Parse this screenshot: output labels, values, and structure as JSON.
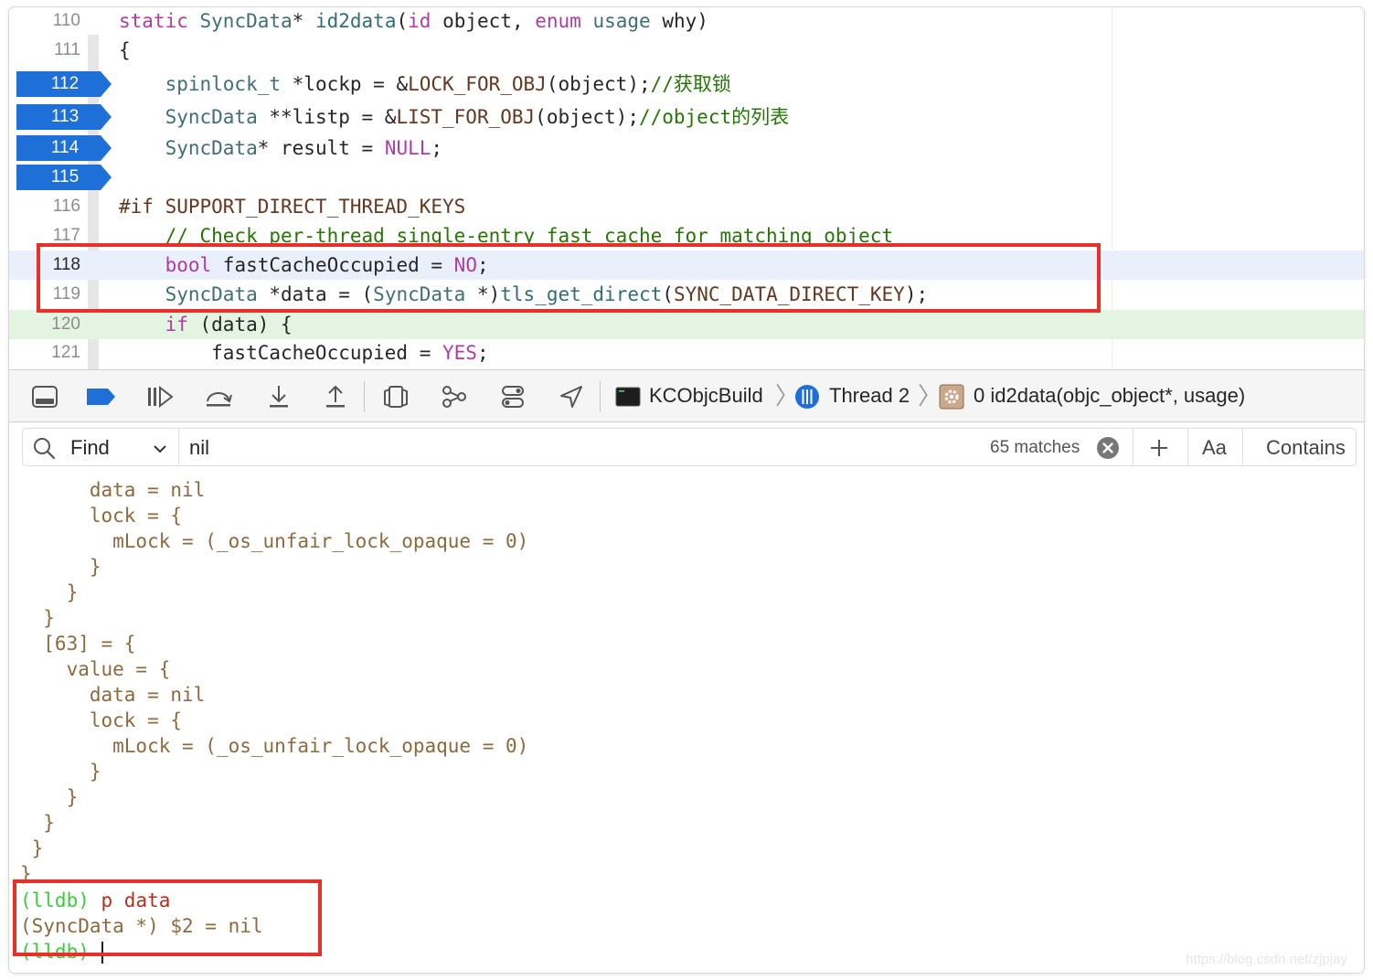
{
  "editor": {
    "lines": [
      {
        "num": "110",
        "type": "normal",
        "tokens": [
          [
            "kw",
            "static "
          ],
          [
            "ty",
            "SyncData"
          ],
          [
            "tx",
            "* "
          ],
          [
            "fn",
            "id2data"
          ],
          [
            "tx",
            "("
          ],
          [
            "kw",
            "id"
          ],
          [
            "tx",
            " object, "
          ],
          [
            "kw",
            "enum "
          ],
          [
            "ty",
            "usage"
          ],
          [
            "tx",
            " why)"
          ]
        ]
      },
      {
        "num": "111",
        "type": "normal",
        "tokens": [
          [
            "tx",
            "{"
          ]
        ]
      },
      {
        "num": "112",
        "type": "breakpoint",
        "tokens": [
          [
            "tx",
            "    "
          ],
          [
            "ty",
            "spinlock_t"
          ],
          [
            "tx",
            " *lockp = &"
          ],
          [
            "mac",
            "LOCK_FOR_OBJ"
          ],
          [
            "tx",
            "(object);"
          ],
          [
            "cm",
            "//获取锁"
          ]
        ]
      },
      {
        "num": "113",
        "type": "breakpoint",
        "tokens": [
          [
            "tx",
            "    "
          ],
          [
            "ty",
            "SyncData"
          ],
          [
            "tx",
            " **listp = &"
          ],
          [
            "mac",
            "LIST_FOR_OBJ"
          ],
          [
            "tx",
            "(object);"
          ],
          [
            "cm",
            "//object的列表"
          ]
        ]
      },
      {
        "num": "114",
        "type": "breakpoint",
        "tokens": [
          [
            "tx",
            "    "
          ],
          [
            "ty",
            "SyncData"
          ],
          [
            "tx",
            "* result = "
          ],
          [
            "kw",
            "NULL"
          ],
          [
            "tx",
            ";"
          ]
        ]
      },
      {
        "num": "115",
        "type": "breakpoint",
        "tokens": []
      },
      {
        "num": "116",
        "type": "normal",
        "tokens": [
          [
            "pre",
            "#if SUPPORT_DIRECT_THREAD_KEYS"
          ]
        ]
      },
      {
        "num": "117",
        "type": "normal",
        "tokens": [
          [
            "tx",
            "    "
          ],
          [
            "cm",
            "// Check per-thread single-entry fast cache for matching object"
          ]
        ]
      },
      {
        "num": "118",
        "type": "current",
        "tokens": [
          [
            "tx",
            "    "
          ],
          [
            "kw",
            "bool"
          ],
          [
            "tx",
            " fastCacheOccupied = "
          ],
          [
            "kw",
            "NO"
          ],
          [
            "tx",
            ";"
          ]
        ]
      },
      {
        "num": "119",
        "type": "normal",
        "tokens": [
          [
            "tx",
            "    "
          ],
          [
            "ty",
            "SyncData"
          ],
          [
            "tx",
            " *data = ("
          ],
          [
            "ty",
            "SyncData"
          ],
          [
            "tx",
            " *)"
          ],
          [
            "fn",
            "tls_get_direct"
          ],
          [
            "tx",
            "("
          ],
          [
            "mac",
            "SYNC_DATA_DIRECT_KEY"
          ],
          [
            "tx",
            ");"
          ]
        ]
      },
      {
        "num": "120",
        "type": "exec",
        "tokens": [
          [
            "tx",
            "    "
          ],
          [
            "kw",
            "if"
          ],
          [
            "tx",
            " (data) {"
          ]
        ]
      },
      {
        "num": "121",
        "type": "normal",
        "tokens": [
          [
            "tx",
            "        fastCacheOccupied = "
          ],
          [
            "kw",
            "YES"
          ],
          [
            "tx",
            ";"
          ]
        ]
      }
    ]
  },
  "debug_bar": {
    "target": "KCObjcBuild",
    "thread": "Thread 2",
    "frame": "0 id2data(objc_object*, usage)"
  },
  "find_bar": {
    "mode": "Find",
    "query": "nil",
    "matches": "65 matches",
    "case_label": "Aa",
    "match_type": "Contains"
  },
  "console": {
    "lines": [
      "      data = nil",
      "      lock = {",
      "        mLock = (_os_unfair_lock_opaque = 0)",
      "      }",
      "    }",
      "  }",
      "  [63] = {",
      "    value = {",
      "      data = nil",
      "      lock = {",
      "        mLock = (_os_unfair_lock_opaque = 0)",
      "      }",
      "    }",
      "  }",
      " }",
      "}"
    ],
    "prompt": "(lldb)",
    "command": "p data",
    "result": "(SyncData *) $2 = nil"
  },
  "watermark": "https://blog.csdn.net/zjpjay",
  "colors": {
    "breakpoint": "#1f6fd8",
    "highlight_box": "#e8302a",
    "current_line": "#e9f0fb",
    "exec_line": "#e3f4e1"
  }
}
